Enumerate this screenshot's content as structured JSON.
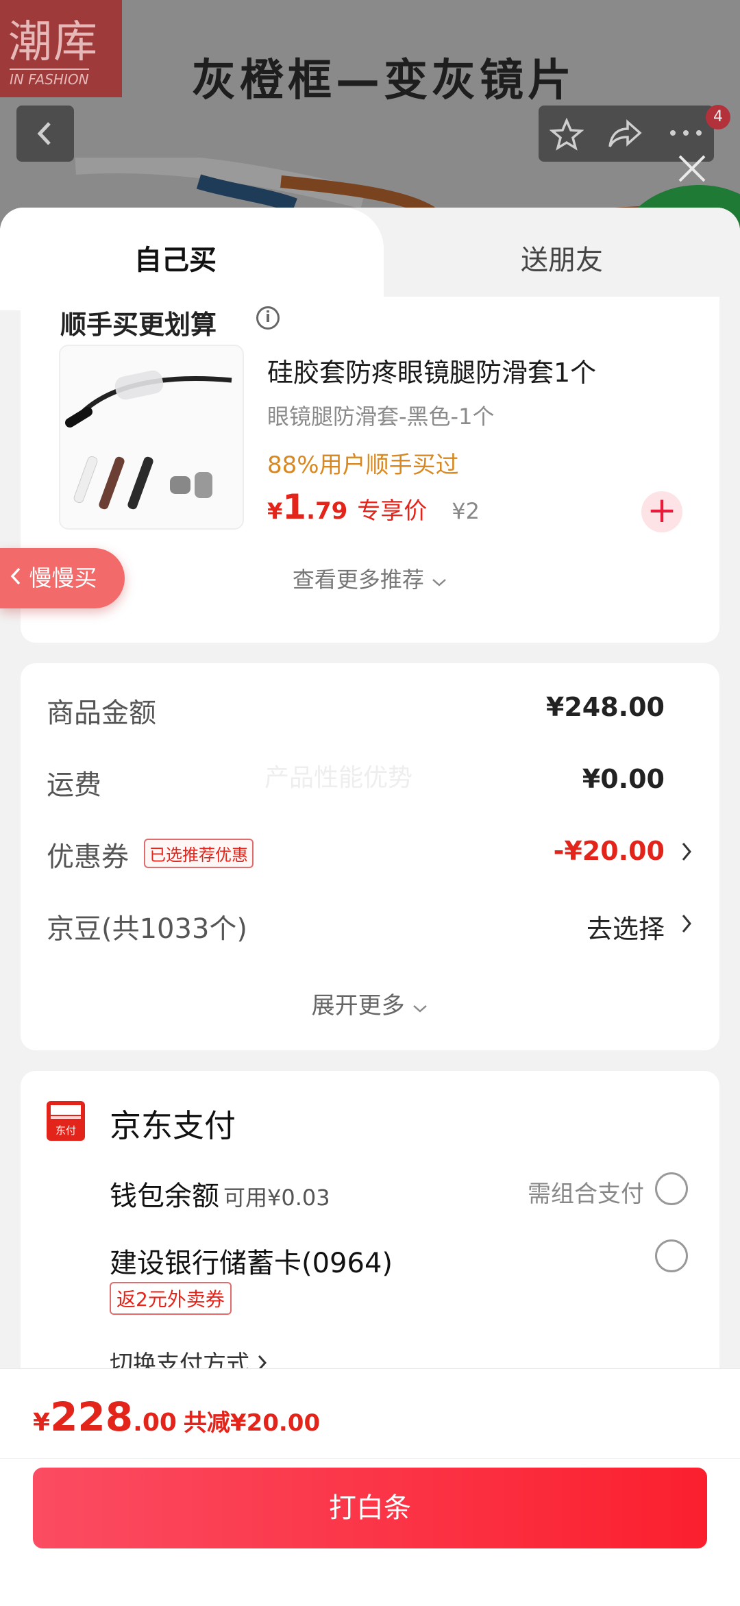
{
  "background": {
    "logo_big": "潮库",
    "logo_small": "IN FASHION",
    "title": "灰橙框—变灰镜片",
    "badge_count": "4"
  },
  "tabs": {
    "self": "自己买",
    "friend": "送朋友"
  },
  "recommend": {
    "heading": "顺手买更划算",
    "product": {
      "name": "硅胶套防疼眼镜腿防滑套1个",
      "spec": "眼镜腿防滑套-黑色-1个",
      "rate": "88%用户顺手买过",
      "price_currency": "¥",
      "price_int": "1",
      "price_dec": ".79",
      "price_label": "专享价",
      "orig_price": "¥2"
    },
    "see_more": "查看更多推荐"
  },
  "slow_buy": "慢慢买",
  "summary": {
    "goods_label": "商品金额",
    "goods_value": "¥248.00",
    "shipping_label": "运费",
    "shipping_value": "¥0.00",
    "coupon_label": "优惠券",
    "coupon_tag": "已选推荐优惠",
    "coupon_value": "-¥20.00",
    "beans_label": "京豆(共1033个)",
    "beans_value": "去选择",
    "watermark": "产品性能优势",
    "expand": "展开更多"
  },
  "payment": {
    "title": "京东支付",
    "logo_text": "东付",
    "wallet_label": "钱包余额",
    "wallet_sub": "可用¥0.03",
    "wallet_need": "需组合支付",
    "bank_label": "建设银行储蓄卡(0964)",
    "bank_tag": "返2元外卖券",
    "switch": "切换支付方式"
  },
  "footer": {
    "total_currency": "¥",
    "total_int": "228",
    "total_dec": ".00",
    "total_save": "共减¥20.00",
    "pay_button": "打白条"
  },
  "colors": {
    "accent": "#e3241b",
    "button_start": "#fb4c62",
    "button_end": "#fb1f2e",
    "rate": "#d9881f"
  }
}
